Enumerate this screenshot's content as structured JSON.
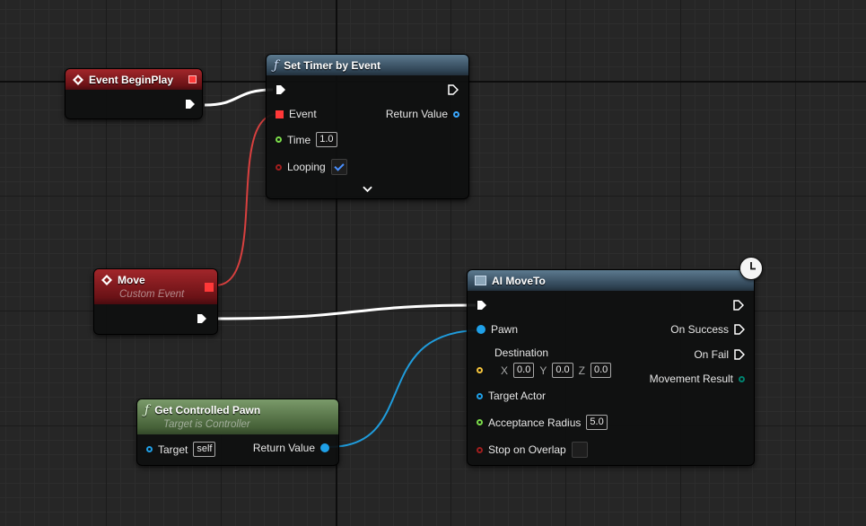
{
  "nodes": {
    "begin_play": {
      "title": "Event BeginPlay"
    },
    "set_timer": {
      "title": "Set Timer by Event",
      "event_label": "Event",
      "return_label": "Return Value",
      "time_label": "Time",
      "time_value": "1.0",
      "looping_label": "Looping",
      "looping_checked": true
    },
    "move": {
      "title": "Move",
      "subtitle": "Custom Event"
    },
    "get_pawn": {
      "title": "Get Controlled Pawn",
      "subtitle": "Target is Controller",
      "target_label": "Target",
      "target_value": "self",
      "return_label": "Return Value"
    },
    "ai_move_to": {
      "title": "AI MoveTo",
      "pawn_label": "Pawn",
      "destination_label": "Destination",
      "x_label": "X",
      "x_value": "0.0",
      "y_label": "Y",
      "y_value": "0.0",
      "z_label": "Z",
      "z_value": "0.0",
      "target_actor_label": "Target Actor",
      "acceptance_radius_label": "Acceptance Radius",
      "acceptance_radius_value": "5.0",
      "stop_on_overlap_label": "Stop on Overlap",
      "on_success_label": "On Success",
      "on_fail_label": "On Fail",
      "movement_result_label": "Movement Result"
    }
  },
  "icons": {
    "event": "event-diamond-icon",
    "function": "function-f-icon",
    "ai_move_to": "ai-node-icon",
    "latent": "clock-icon",
    "expand": "chevron-down-icon"
  },
  "colors": {
    "exec": "#ffffff",
    "delegate": "#ff3838",
    "float": "#7bdc4a",
    "bool": "#8a1414",
    "object": "#00a8f0",
    "vector": "#f5c43c",
    "enum": "#00826f"
  }
}
